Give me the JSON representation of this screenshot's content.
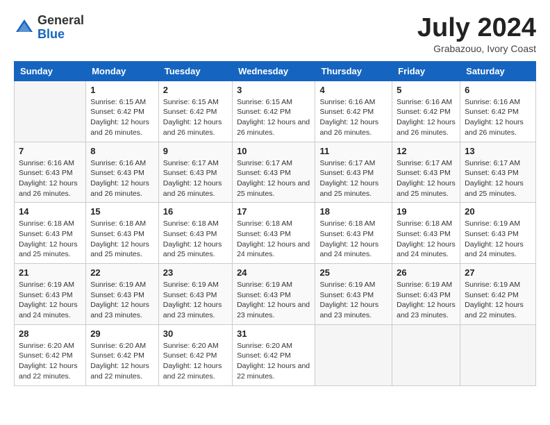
{
  "header": {
    "logo_general": "General",
    "logo_blue": "Blue",
    "month_title": "July 2024",
    "subtitle": "Grabazouo, Ivory Coast"
  },
  "days_of_week": [
    "Sunday",
    "Monday",
    "Tuesday",
    "Wednesday",
    "Thursday",
    "Friday",
    "Saturday"
  ],
  "weeks": [
    [
      {
        "day": "",
        "sunrise": "",
        "sunset": "",
        "daylight": ""
      },
      {
        "day": "1",
        "sunrise": "Sunrise: 6:15 AM",
        "sunset": "Sunset: 6:42 PM",
        "daylight": "Daylight: 12 hours and 26 minutes."
      },
      {
        "day": "2",
        "sunrise": "Sunrise: 6:15 AM",
        "sunset": "Sunset: 6:42 PM",
        "daylight": "Daylight: 12 hours and 26 minutes."
      },
      {
        "day": "3",
        "sunrise": "Sunrise: 6:15 AM",
        "sunset": "Sunset: 6:42 PM",
        "daylight": "Daylight: 12 hours and 26 minutes."
      },
      {
        "day": "4",
        "sunrise": "Sunrise: 6:16 AM",
        "sunset": "Sunset: 6:42 PM",
        "daylight": "Daylight: 12 hours and 26 minutes."
      },
      {
        "day": "5",
        "sunrise": "Sunrise: 6:16 AM",
        "sunset": "Sunset: 6:42 PM",
        "daylight": "Daylight: 12 hours and 26 minutes."
      },
      {
        "day": "6",
        "sunrise": "Sunrise: 6:16 AM",
        "sunset": "Sunset: 6:42 PM",
        "daylight": "Daylight: 12 hours and 26 minutes."
      }
    ],
    [
      {
        "day": "7",
        "sunrise": "Sunrise: 6:16 AM",
        "sunset": "Sunset: 6:43 PM",
        "daylight": "Daylight: 12 hours and 26 minutes."
      },
      {
        "day": "8",
        "sunrise": "Sunrise: 6:16 AM",
        "sunset": "Sunset: 6:43 PM",
        "daylight": "Daylight: 12 hours and 26 minutes."
      },
      {
        "day": "9",
        "sunrise": "Sunrise: 6:17 AM",
        "sunset": "Sunset: 6:43 PM",
        "daylight": "Daylight: 12 hours and 26 minutes."
      },
      {
        "day": "10",
        "sunrise": "Sunrise: 6:17 AM",
        "sunset": "Sunset: 6:43 PM",
        "daylight": "Daylight: 12 hours and 25 minutes."
      },
      {
        "day": "11",
        "sunrise": "Sunrise: 6:17 AM",
        "sunset": "Sunset: 6:43 PM",
        "daylight": "Daylight: 12 hours and 25 minutes."
      },
      {
        "day": "12",
        "sunrise": "Sunrise: 6:17 AM",
        "sunset": "Sunset: 6:43 PM",
        "daylight": "Daylight: 12 hours and 25 minutes."
      },
      {
        "day": "13",
        "sunrise": "Sunrise: 6:17 AM",
        "sunset": "Sunset: 6:43 PM",
        "daylight": "Daylight: 12 hours and 25 minutes."
      }
    ],
    [
      {
        "day": "14",
        "sunrise": "Sunrise: 6:18 AM",
        "sunset": "Sunset: 6:43 PM",
        "daylight": "Daylight: 12 hours and 25 minutes."
      },
      {
        "day": "15",
        "sunrise": "Sunrise: 6:18 AM",
        "sunset": "Sunset: 6:43 PM",
        "daylight": "Daylight: 12 hours and 25 minutes."
      },
      {
        "day": "16",
        "sunrise": "Sunrise: 6:18 AM",
        "sunset": "Sunset: 6:43 PM",
        "daylight": "Daylight: 12 hours and 25 minutes."
      },
      {
        "day": "17",
        "sunrise": "Sunrise: 6:18 AM",
        "sunset": "Sunset: 6:43 PM",
        "daylight": "Daylight: 12 hours and 24 minutes."
      },
      {
        "day": "18",
        "sunrise": "Sunrise: 6:18 AM",
        "sunset": "Sunset: 6:43 PM",
        "daylight": "Daylight: 12 hours and 24 minutes."
      },
      {
        "day": "19",
        "sunrise": "Sunrise: 6:18 AM",
        "sunset": "Sunset: 6:43 PM",
        "daylight": "Daylight: 12 hours and 24 minutes."
      },
      {
        "day": "20",
        "sunrise": "Sunrise: 6:19 AM",
        "sunset": "Sunset: 6:43 PM",
        "daylight": "Daylight: 12 hours and 24 minutes."
      }
    ],
    [
      {
        "day": "21",
        "sunrise": "Sunrise: 6:19 AM",
        "sunset": "Sunset: 6:43 PM",
        "daylight": "Daylight: 12 hours and 24 minutes."
      },
      {
        "day": "22",
        "sunrise": "Sunrise: 6:19 AM",
        "sunset": "Sunset: 6:43 PM",
        "daylight": "Daylight: 12 hours and 23 minutes."
      },
      {
        "day": "23",
        "sunrise": "Sunrise: 6:19 AM",
        "sunset": "Sunset: 6:43 PM",
        "daylight": "Daylight: 12 hours and 23 minutes."
      },
      {
        "day": "24",
        "sunrise": "Sunrise: 6:19 AM",
        "sunset": "Sunset: 6:43 PM",
        "daylight": "Daylight: 12 hours and 23 minutes."
      },
      {
        "day": "25",
        "sunrise": "Sunrise: 6:19 AM",
        "sunset": "Sunset: 6:43 PM",
        "daylight": "Daylight: 12 hours and 23 minutes."
      },
      {
        "day": "26",
        "sunrise": "Sunrise: 6:19 AM",
        "sunset": "Sunset: 6:43 PM",
        "daylight": "Daylight: 12 hours and 23 minutes."
      },
      {
        "day": "27",
        "sunrise": "Sunrise: 6:19 AM",
        "sunset": "Sunset: 6:42 PM",
        "daylight": "Daylight: 12 hours and 22 minutes."
      }
    ],
    [
      {
        "day": "28",
        "sunrise": "Sunrise: 6:20 AM",
        "sunset": "Sunset: 6:42 PM",
        "daylight": "Daylight: 12 hours and 22 minutes."
      },
      {
        "day": "29",
        "sunrise": "Sunrise: 6:20 AM",
        "sunset": "Sunset: 6:42 PM",
        "daylight": "Daylight: 12 hours and 22 minutes."
      },
      {
        "day": "30",
        "sunrise": "Sunrise: 6:20 AM",
        "sunset": "Sunset: 6:42 PM",
        "daylight": "Daylight: 12 hours and 22 minutes."
      },
      {
        "day": "31",
        "sunrise": "Sunrise: 6:20 AM",
        "sunset": "Sunset: 6:42 PM",
        "daylight": "Daylight: 12 hours and 22 minutes."
      },
      {
        "day": "",
        "sunrise": "",
        "sunset": "",
        "daylight": ""
      },
      {
        "day": "",
        "sunrise": "",
        "sunset": "",
        "daylight": ""
      },
      {
        "day": "",
        "sunrise": "",
        "sunset": "",
        "daylight": ""
      }
    ]
  ]
}
